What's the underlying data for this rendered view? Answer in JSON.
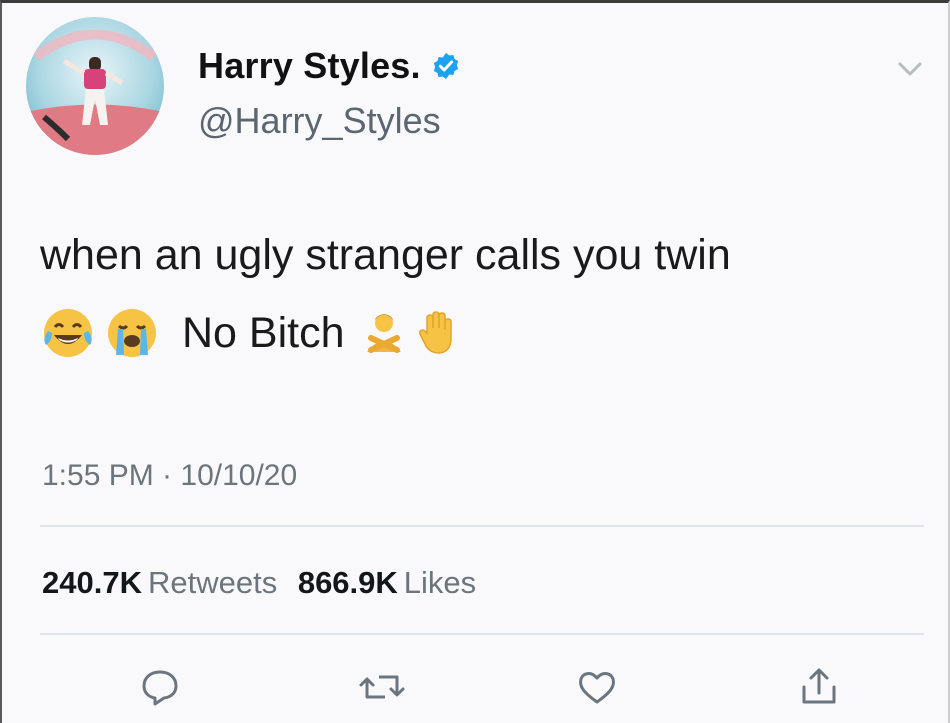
{
  "author": {
    "display_name": "Harry Styles.",
    "handle": "@Harry_Styles",
    "verified": true,
    "avatar_icon": "profile-photo"
  },
  "tweet": {
    "line1": "when an ugly stranger calls you twin",
    "line2_text": "No Bitch",
    "emojis_before": [
      "face-with-tears-of-joy",
      "loudly-crying-face"
    ],
    "emojis_after": [
      "person-gesturing-no",
      "raised-hand"
    ]
  },
  "meta": {
    "timestamp": "1:55 PM · 10/10/20"
  },
  "stats": {
    "retweets_count": "240.7K",
    "retweets_label": "Retweets",
    "likes_count": "866.9K",
    "likes_label": "Likes"
  },
  "actions": [
    {
      "name": "reply",
      "icon": "reply-icon"
    },
    {
      "name": "retweet",
      "icon": "retweet-icon"
    },
    {
      "name": "like",
      "icon": "heart-icon"
    },
    {
      "name": "share",
      "icon": "share-icon"
    }
  ],
  "colors": {
    "verified_blue": "#1da1f2",
    "text_primary": "#14171a",
    "text_secondary": "#6c757d",
    "icon_gray": "#657786",
    "emoji_yellow": "#f6c344"
  }
}
